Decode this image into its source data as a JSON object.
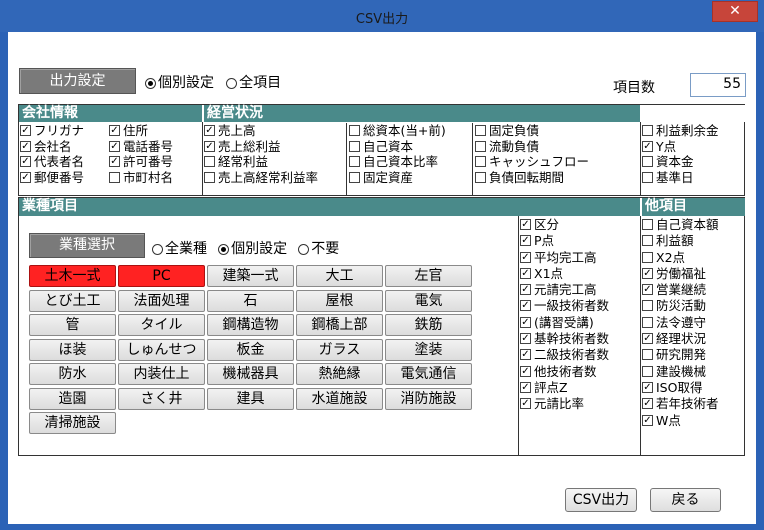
{
  "window": {
    "title": "CSV出力",
    "close_glyph": "✕"
  },
  "output_settings": {
    "label": "出力設定",
    "options": [
      {
        "label": "個別設定",
        "selected": true
      },
      {
        "label": "全項目",
        "selected": false
      }
    ],
    "item_count_label": "項目数",
    "item_count_value": "55"
  },
  "company_info": {
    "header": "会社情報",
    "col1": [
      {
        "label": "フリガナ",
        "checked": true
      },
      {
        "label": "会社名",
        "checked": true
      },
      {
        "label": "代表者名",
        "checked": true
      },
      {
        "label": "郵便番号",
        "checked": true
      }
    ],
    "col2": [
      {
        "label": "住所",
        "checked": true
      },
      {
        "label": "電話番号",
        "checked": true
      },
      {
        "label": "許可番号",
        "checked": true
      },
      {
        "label": "市町村名",
        "checked": false
      }
    ]
  },
  "business_status": {
    "header": "経営状況",
    "col1": [
      {
        "label": "売上高",
        "checked": true
      },
      {
        "label": "売上総利益",
        "checked": true
      },
      {
        "label": "経常利益",
        "checked": false
      },
      {
        "label": "売上高経常利益率",
        "checked": false
      }
    ],
    "col2": [
      {
        "label": "総資本(当+前)",
        "checked": false
      },
      {
        "label": "自己資本",
        "checked": false
      },
      {
        "label": "自己資本比率",
        "checked": false
      },
      {
        "label": "固定資産",
        "checked": false
      }
    ],
    "col3": [
      {
        "label": "固定負債",
        "checked": false
      },
      {
        "label": "流動負債",
        "checked": false
      },
      {
        "label": "キャッシュフロー",
        "checked": false
      },
      {
        "label": "負債回転期間",
        "checked": false
      }
    ],
    "col4": [
      {
        "label": "利益剰余金",
        "checked": false
      },
      {
        "label": "Y点",
        "checked": true
      },
      {
        "label": "資本金",
        "checked": false
      },
      {
        "label": "基準日",
        "checked": false
      }
    ]
  },
  "industry": {
    "header": "業種項目",
    "select_label": "業種選択",
    "options": [
      {
        "label": "全業種",
        "selected": false
      },
      {
        "label": "個別設定",
        "selected": true
      },
      {
        "label": "不要",
        "selected": false
      }
    ],
    "buttons": [
      {
        "label": "土木一式",
        "active": true
      },
      {
        "label": "PC",
        "active": true
      },
      {
        "label": "建築一式",
        "active": false
      },
      {
        "label": "大工",
        "active": false
      },
      {
        "label": "左官",
        "active": false
      },
      {
        "label": "とび土工",
        "active": false
      },
      {
        "label": "法面処理",
        "active": false
      },
      {
        "label": "石",
        "active": false
      },
      {
        "label": "屋根",
        "active": false
      },
      {
        "label": "電気",
        "active": false
      },
      {
        "label": "管",
        "active": false
      },
      {
        "label": "タイル",
        "active": false
      },
      {
        "label": "鋼構造物",
        "active": false
      },
      {
        "label": "鋼橋上部",
        "active": false
      },
      {
        "label": "鉄筋",
        "active": false
      },
      {
        "label": "ほ装",
        "active": false
      },
      {
        "label": "しゅんせつ",
        "active": false
      },
      {
        "label": "板金",
        "active": false
      },
      {
        "label": "ガラス",
        "active": false
      },
      {
        "label": "塗装",
        "active": false
      },
      {
        "label": "防水",
        "active": false
      },
      {
        "label": "内装仕上",
        "active": false
      },
      {
        "label": "機械器具",
        "active": false
      },
      {
        "label": "熱絶縁",
        "active": false
      },
      {
        "label": "電気通信",
        "active": false
      },
      {
        "label": "造園",
        "active": false
      },
      {
        "label": "さく井",
        "active": false
      },
      {
        "label": "建具",
        "active": false
      },
      {
        "label": "水道施設",
        "active": false
      },
      {
        "label": "消防施設",
        "active": false
      },
      {
        "label": "清掃施設",
        "active": false
      }
    ],
    "fields": [
      {
        "label": "区分",
        "checked": true
      },
      {
        "label": "P点",
        "checked": true
      },
      {
        "label": "平均完工高",
        "checked": true
      },
      {
        "label": "X1点",
        "checked": true
      },
      {
        "label": "元請完工高",
        "checked": true
      },
      {
        "label": "一級技術者数",
        "checked": true
      },
      {
        "label": "(講習受講)",
        "checked": true
      },
      {
        "label": "基幹技術者数",
        "checked": true
      },
      {
        "label": "二級技術者数",
        "checked": true
      },
      {
        "label": "他技術者数",
        "checked": true
      },
      {
        "label": "評点Z",
        "checked": true
      },
      {
        "label": "元請比率",
        "checked": true
      }
    ]
  },
  "other": {
    "header": "他項目",
    "fields": [
      {
        "label": "自己資本額",
        "checked": false
      },
      {
        "label": "利益額",
        "checked": false
      },
      {
        "label": "X2点",
        "checked": false
      },
      {
        "label": "労働福祉",
        "checked": true
      },
      {
        "label": "営業継続",
        "checked": true
      },
      {
        "label": "防災活動",
        "checked": false
      },
      {
        "label": "法令遵守",
        "checked": false
      },
      {
        "label": "経理状況",
        "checked": true
      },
      {
        "label": "研究開発",
        "checked": false
      },
      {
        "label": "建設機械",
        "checked": false
      },
      {
        "label": "ISO取得",
        "checked": true
      },
      {
        "label": "若年技術者",
        "checked": true
      },
      {
        "label": "W点",
        "checked": true
      }
    ]
  },
  "footer": {
    "csv_label": "CSV出力",
    "back_label": "戻る"
  },
  "check_glyph": "✓"
}
